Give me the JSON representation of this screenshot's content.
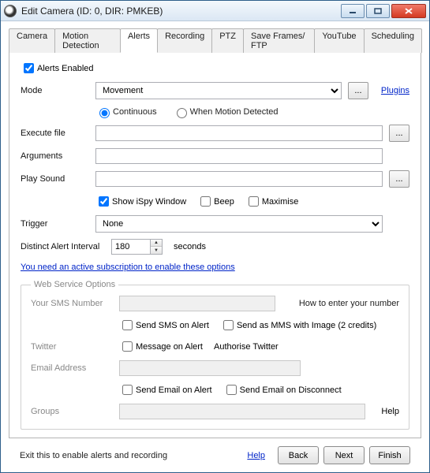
{
  "window": {
    "title": "Edit Camera (ID: 0, DIR: PMKEB)"
  },
  "tabs": [
    "Camera",
    "Motion Detection",
    "Alerts",
    "Recording",
    "PTZ",
    "Save Frames/ FTP",
    "YouTube",
    "Scheduling"
  ],
  "active_tab": 2,
  "alerts": {
    "enabled_label": "Alerts Enabled",
    "mode_label": "Mode",
    "mode_value": "Movement",
    "plugins_link": "Plugins",
    "radio_continuous": "Continuous",
    "radio_when_motion": "When Motion Detected",
    "exec_label": "Execute file",
    "args_label": "Arguments",
    "playsound_label": "Play Sound",
    "chk_show_ispy": "Show iSpy Window",
    "chk_beep": "Beep",
    "chk_maximise": "Maximise",
    "trigger_label": "Trigger",
    "trigger_value": "None",
    "interval_label": "Distinct Alert Interval",
    "interval_value": "180",
    "interval_unit": "seconds",
    "subscription_link": "You need an active subscription to enable these options"
  },
  "webservice": {
    "legend": "Web Service Options",
    "sms_label": "Your SMS Number",
    "howto_link": "How to enter your number",
    "chk_sms_alert": "Send SMS on Alert",
    "chk_mms": "Send as MMS with Image (2 credits)",
    "twitter_label": "Twitter",
    "chk_msg_alert": "Message on Alert",
    "auth_twitter": "Authorise Twitter",
    "email_label": "Email Address",
    "chk_email_alert": "Send Email on Alert",
    "chk_email_disc": "Send Email on Disconnect",
    "groups_label": "Groups",
    "help_link": "Help"
  },
  "footer": {
    "status": "Exit this to enable alerts and recording",
    "help": "Help",
    "back": "Back",
    "next": "Next",
    "finish": "Finish"
  },
  "ellipsis": "..."
}
